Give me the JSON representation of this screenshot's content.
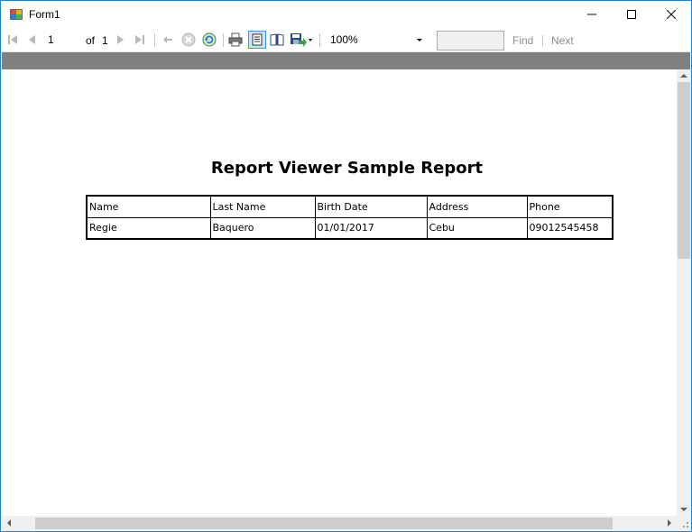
{
  "window": {
    "title": "Form1"
  },
  "icons": {
    "app": "form-app-icon",
    "first_page": "first-page-icon",
    "previous_page": "previous-page-icon",
    "next_page": "next-page-icon",
    "last_page": "last-page-icon",
    "back": "back-icon",
    "stop": "stop-icon",
    "refresh": "refresh-icon",
    "print": "print-icon",
    "print_layout": "print-layout-icon",
    "page_setup": "page-setup-icon",
    "export": "export-icon"
  },
  "toolbar": {
    "current_page": "1",
    "of_label": "of",
    "total_pages": "1",
    "zoom": "100%",
    "find_text": "",
    "find_label": "Find",
    "next_label": "Next"
  },
  "report": {
    "title": "Report Viewer Sample Report",
    "columns": [
      "Name",
      "Last Name",
      "Birth Date",
      "Address",
      "Phone"
    ],
    "rows": [
      [
        "Regie",
        "Baquero",
        "01/01/2017",
        "Cebu",
        "09012545458"
      ]
    ]
  },
  "colors": {
    "window_border": "#1883d7",
    "gray_strip": "#808080",
    "scrollbar_track": "#f0f0f0",
    "scrollbar_thumb": "#cdcdcd",
    "disabled_text": "#8c8c8c"
  }
}
